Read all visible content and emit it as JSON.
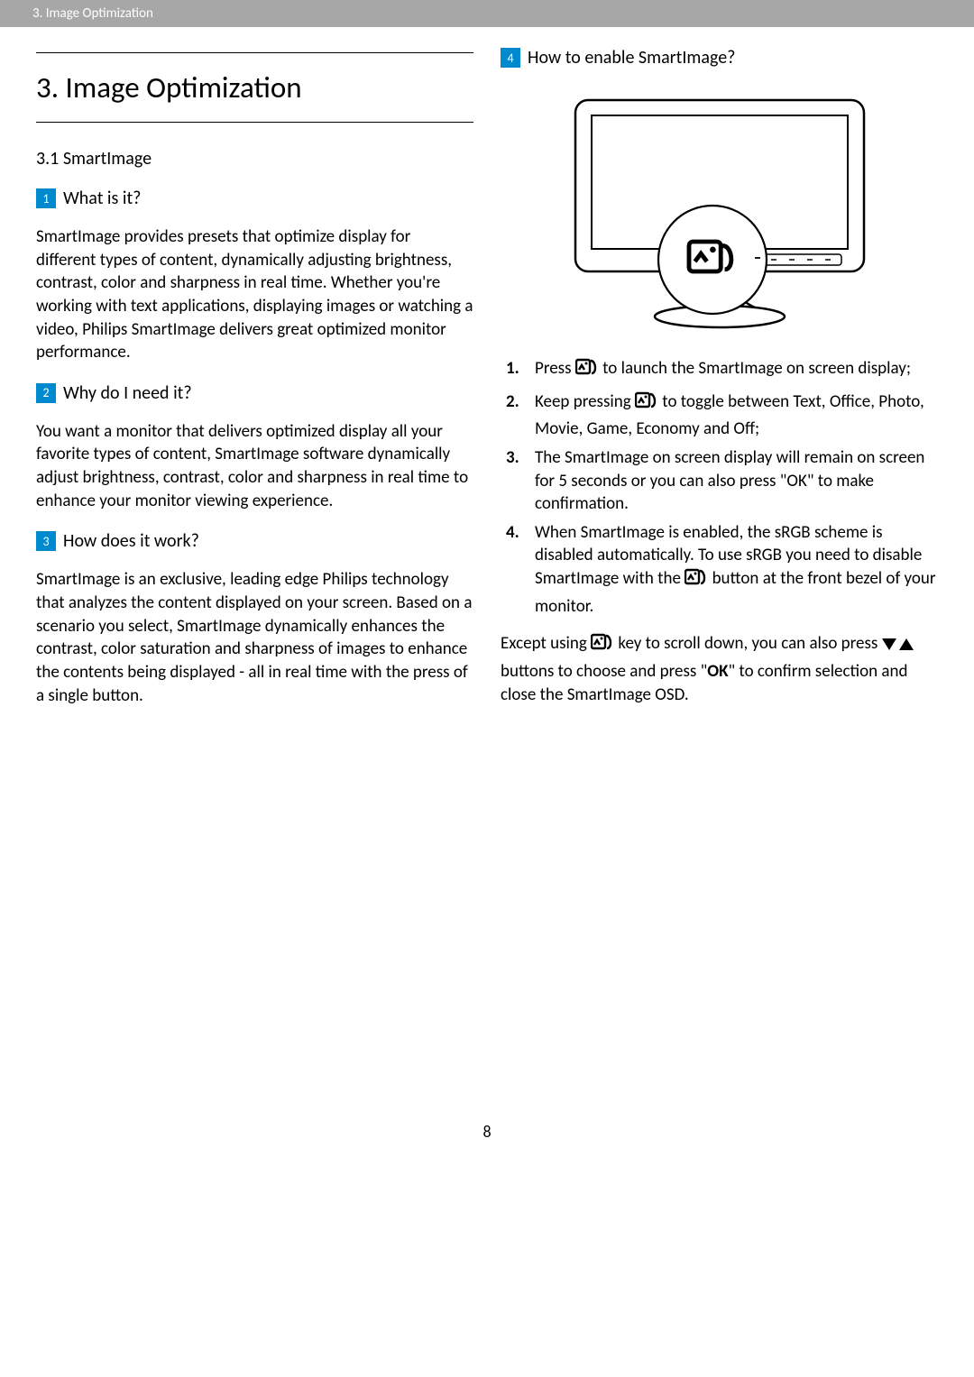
{
  "header": {
    "breadcrumb": "3. Image Optimization"
  },
  "left": {
    "chapter_title": "3.  Image Optimization",
    "section_title": "3.1 SmartImage",
    "q1": {
      "num": "1",
      "text": "What is it?"
    },
    "p1": "SmartImage provides presets that optimize display for different types of content, dynamically adjusting brightness, contrast, color and sharpness in real time. Whether you're working with text applications, displaying images or watching a video, Philips SmartImage delivers great optimized monitor performance.",
    "q2": {
      "num": "2",
      "text": "Why do I need it?"
    },
    "p2": "You want a monitor that delivers optimized display all your favorite types of content, SmartImage software dynamically adjust brightness, contrast, color and sharpness in real time to enhance your monitor viewing experience.",
    "q3": {
      "num": "3",
      "text": "How does it work?"
    },
    "p3": "SmartImage is an exclusive, leading edge Philips technology that analyzes the content displayed on your screen. Based on a scenario you select, SmartImage dynamically enhances the contrast, color saturation and sharpness of images to enhance the contents being displayed - all in real time with the press of a single button."
  },
  "right": {
    "q4": {
      "num": "4",
      "text": "How to enable SmartImage?"
    },
    "li1_a": "Press ",
    "li1_b": " to launch the SmartImage on screen display;",
    "li2_a": "Keep pressing ",
    "li2_b": " to toggle between Text, Office, Photo, Movie, Game, Economy and Off;",
    "li3": "The SmartImage on screen display will remain on screen for 5 seconds or you can also press \"OK\" to make confirmation.",
    "li4_a": "When SmartImage is enabled, the sRGB scheme is disabled automatically. To use sRGB you need to disable SmartImage with the ",
    "li4_b": " button at the front bezel of your monitor.",
    "note_a": "Except using ",
    "note_b": " key to scroll down, you can also press ",
    "note_c": " buttons to choose and press \"",
    "note_ok": "OK",
    "note_d": "\" to confirm selection and close the SmartImage OSD."
  },
  "page_number": "8"
}
